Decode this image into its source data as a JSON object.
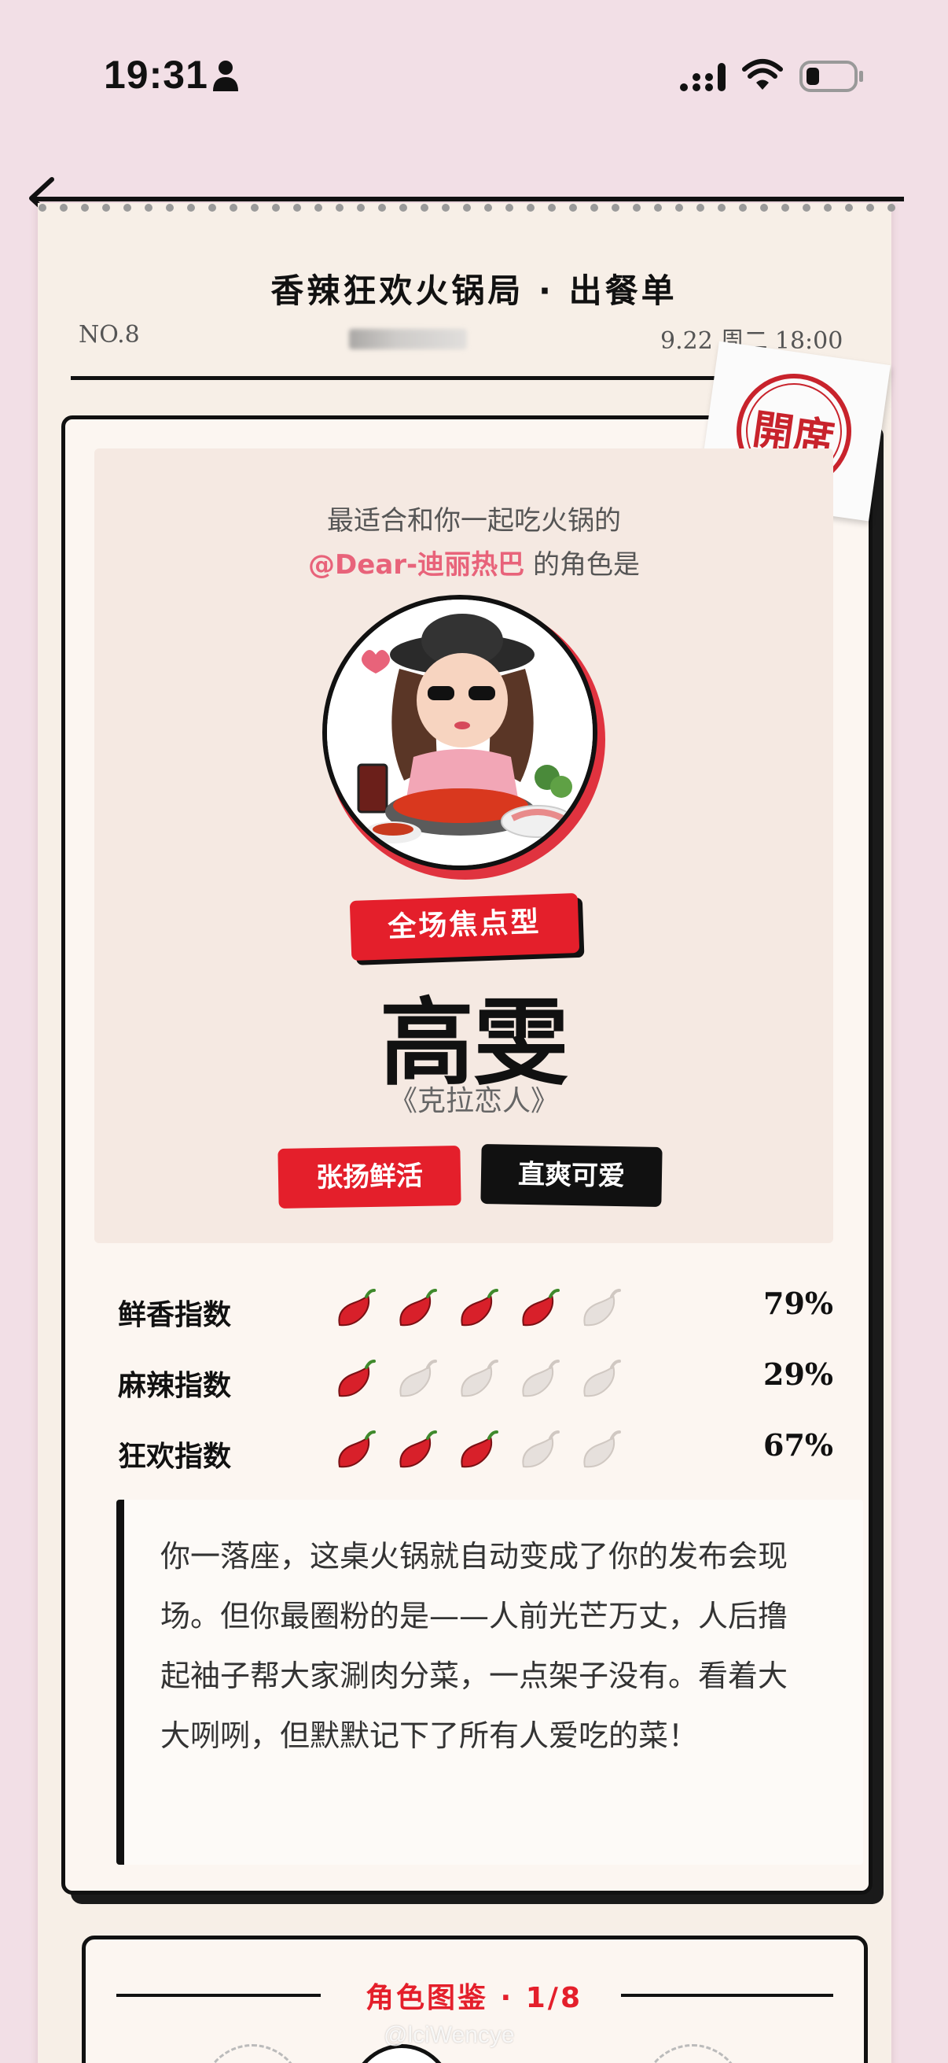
{
  "status_bar": {
    "time": "19:31"
  },
  "receipt": {
    "title": "香辣狂欢火锅局 · 出餐单",
    "order_no": "NO.8",
    "datetime": "9.22 周二 18:00",
    "stamp_text": "開席"
  },
  "card": {
    "intro_line1": "最适合和你一起吃火锅的",
    "handle": "@Dear-迪丽热巴",
    "intro_line2_suffix": " 的角色是",
    "role_type": "全场焦点型",
    "role_name": "高雯",
    "role_source": "《克拉恋人》",
    "tags": [
      "张扬鲜活",
      "直爽可爱"
    ],
    "ratings": [
      {
        "label": "鲜香指数",
        "filled": 4,
        "total": 5,
        "percent": "79%"
      },
      {
        "label": "麻辣指数",
        "filled": 1,
        "total": 5,
        "percent": "29%"
      },
      {
        "label": "狂欢指数",
        "filled": 3,
        "total": 5,
        "percent": "67%"
      }
    ],
    "description": "你一落座，这桌火锅就自动变成了你的发布会现场。但你最圈粉的是——人前光芒万丈，人后撸起袖子帮大家涮肉分菜，一点架子没有。看着大大咧咧，但默默记下了所有人爱吃的菜！"
  },
  "gallery": {
    "title": "角色图鉴 · 1/8"
  },
  "watermark": "@lciWencye",
  "colors": {
    "accent_red": "#e41f2b",
    "handle_pink": "#e8637a",
    "background_pink": "#f2dfe6",
    "paper": "#f7efe7"
  }
}
